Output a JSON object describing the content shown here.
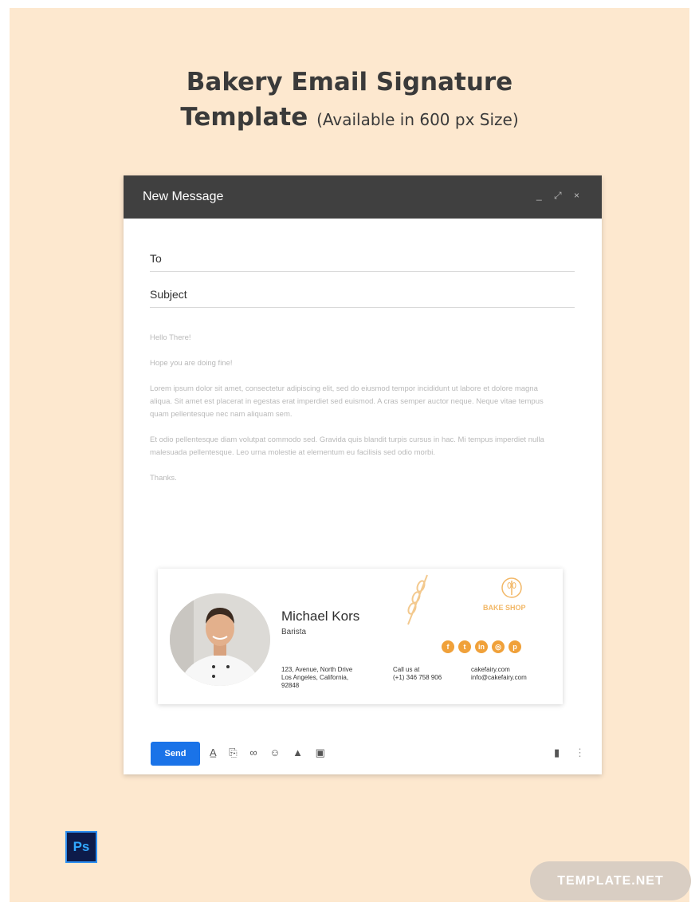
{
  "headline": {
    "line1": "Bakery Email Signature",
    "line2_main": "Template",
    "line2_small": "(Available in 600 px Size)"
  },
  "compose": {
    "title": "New Message",
    "window_controls": "_ ⤢ ×",
    "to_label": "To",
    "subject_label": "Subject",
    "body": {
      "greeting": "Hello There!",
      "line2": "Hope you are doing fine!",
      "para1": "Lorem ipsum dolor sit amet, consectetur adipiscing elit, sed do eiusmod tempor incididunt ut labore et dolore magna aliqua. Sit amet est placerat in egestas erat imperdiet sed euismod. A cras semper auctor neque. Neque vitae tempus quam pellentesque nec nam aliquam sem.",
      "para2": " Et odio pellentesque diam volutpat commodo sed. Gravida quis blandit turpis cursus in hac. Mi tempus imperdiet nulla malesuada pellentesque. Leo urna molestie at elementum eu facilisis sed odio morbi.",
      "closing": "Thanks."
    },
    "send_label": "Send"
  },
  "signature": {
    "name": "Michael Kors",
    "role": "Barista",
    "address_l1": "123, Avenue, North Drive",
    "address_l2": "Los Angeles, California,",
    "address_l3": "92848",
    "call_l1": "Call us at",
    "call_l2": "(+1) 346 758 906",
    "web_l1": "cakefairy.com",
    "web_l2": "info@cakefairy.com",
    "brand": "BAKE SHOP",
    "social_icons": [
      "facebook-icon",
      "twitter-icon",
      "linkedin-icon",
      "instagram-icon",
      "pinterest-icon"
    ],
    "accent_color": "#f0a13a"
  },
  "badges": {
    "ps": "Ps",
    "template_net": "TEMPLATE.NET"
  }
}
